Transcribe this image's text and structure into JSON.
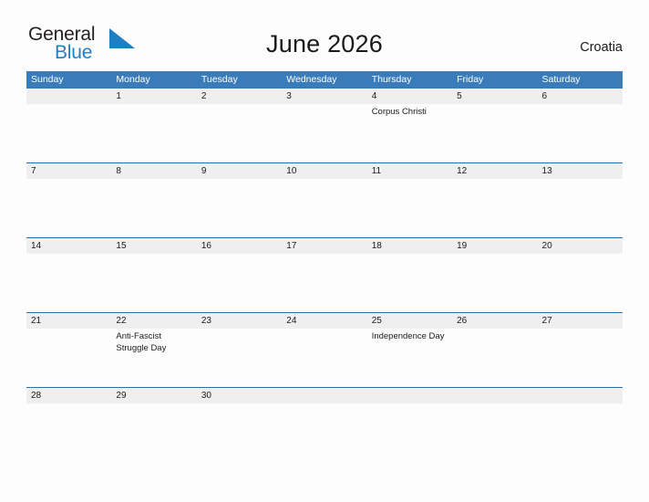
{
  "brand": {
    "name_part1": "General",
    "name_part2": "Blue",
    "flag_icon": "blue-triangle-flag-icon",
    "accent_color": "#1f7fc4"
  },
  "header": {
    "title": "June 2026",
    "country": "Croatia"
  },
  "colors": {
    "header_band": "#3a7cb9",
    "date_band": "#efefef",
    "row_divider": "#2e6da4",
    "page_background": "#fdfdfd",
    "text": "#1a1a1a"
  },
  "weekday_headers": [
    "Sunday",
    "Monday",
    "Tuesday",
    "Wednesday",
    "Thursday",
    "Friday",
    "Saturday"
  ],
  "weeks": [
    {
      "dates": [
        "",
        "1",
        "2",
        "3",
        "4",
        "5",
        "6"
      ],
      "events": [
        "",
        "",
        "",
        "",
        "Corpus Christi",
        "",
        ""
      ]
    },
    {
      "dates": [
        "7",
        "8",
        "9",
        "10",
        "11",
        "12",
        "13"
      ],
      "events": [
        "",
        "",
        "",
        "",
        "",
        "",
        ""
      ]
    },
    {
      "dates": [
        "14",
        "15",
        "16",
        "17",
        "18",
        "19",
        "20"
      ],
      "events": [
        "",
        "",
        "",
        "",
        "",
        "",
        ""
      ]
    },
    {
      "dates": [
        "21",
        "22",
        "23",
        "24",
        "25",
        "26",
        "27"
      ],
      "events": [
        "",
        "Anti-Fascist Struggle Day",
        "",
        "",
        "Independence Day",
        "",
        ""
      ]
    },
    {
      "dates": [
        "28",
        "29",
        "30",
        "",
        "",
        "",
        ""
      ],
      "events": [
        "",
        "",
        "",
        "",
        "",
        "",
        ""
      ]
    }
  ]
}
